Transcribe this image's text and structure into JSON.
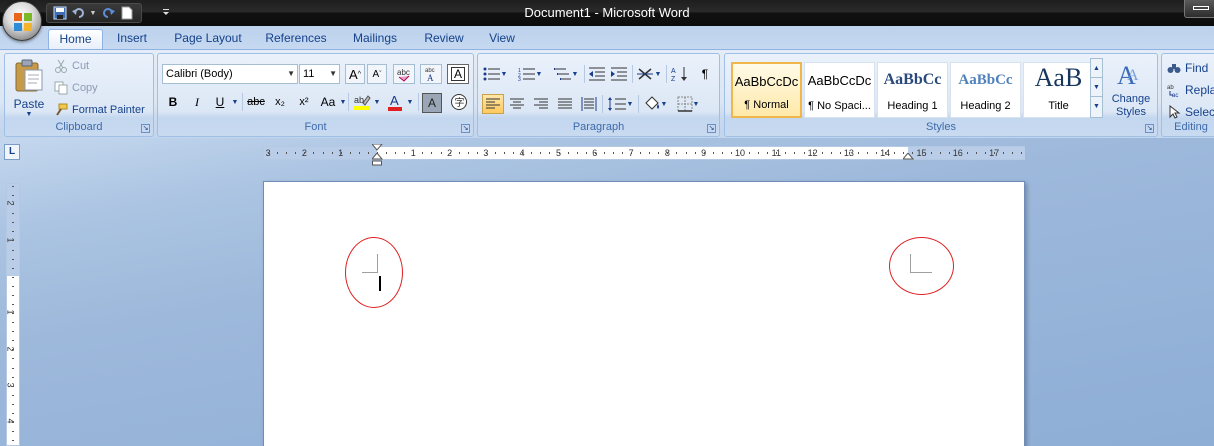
{
  "window": {
    "title": "Document1 - Microsoft Word"
  },
  "quick_access": [
    "save-icon",
    "undo-icon",
    "redo-icon",
    "new-document-icon"
  ],
  "tabs": [
    "Home",
    "Insert",
    "Page Layout",
    "References",
    "Mailings",
    "Review",
    "View"
  ],
  "active_tab": "Home",
  "clipboard": {
    "paste": "Paste",
    "cut": "Cut",
    "copy": "Copy",
    "format_painter": "Format Painter",
    "label": "Clipboard"
  },
  "font": {
    "name": "Calibri (Body)",
    "size": "11",
    "label": "Font",
    "grow": "A",
    "shrink": "A",
    "bold": "B",
    "italic": "I",
    "underline": "U",
    "strike": "abc",
    "subscript": "x₂",
    "superscript": "x²",
    "change_case": "Aa",
    "text_effect": "A"
  },
  "paragraph": {
    "label": "Paragraph",
    "show_marks": "¶"
  },
  "styles": {
    "label": "Styles",
    "items": [
      {
        "preview": "AaBbCcDc",
        "name": "¶ Normal"
      },
      {
        "preview": "AaBbCcDc",
        "name": "¶ No Spaci..."
      },
      {
        "preview": "AaBbCc",
        "name": "Heading 1"
      },
      {
        "preview": "AaBbCc",
        "name": "Heading 2"
      },
      {
        "preview": "AaB",
        "name": "Title"
      }
    ],
    "change_styles": "Change Styles"
  },
  "editing": {
    "label": "Editing",
    "find": "Find",
    "replace": "Repla",
    "select": "Selec"
  },
  "ruler": {
    "h_labels": [
      "3",
      "2",
      "1",
      "1",
      "2",
      "3",
      "4",
      "5",
      "6",
      "7",
      "8",
      "9",
      "10",
      "11",
      "12",
      "13",
      "14",
      "15",
      "16",
      "17"
    ],
    "v_labels": [
      "2",
      "1",
      "1",
      "2",
      "3",
      "4"
    ]
  },
  "tab_selector": "L"
}
